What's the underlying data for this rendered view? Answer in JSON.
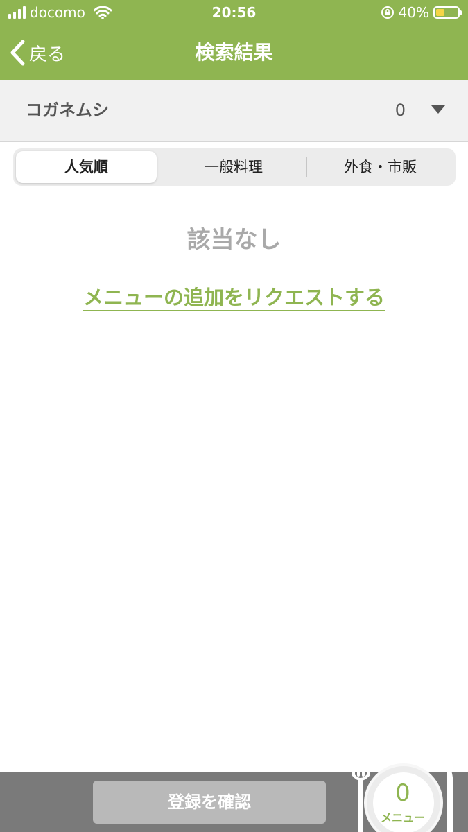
{
  "status_bar": {
    "carrier": "docomo",
    "time": "20:56",
    "battery_percent": "40%",
    "battery_level": 0.4,
    "battery_color": "#f5d547"
  },
  "nav": {
    "back_label": "戻る",
    "title": "検索結果",
    "background_color": "#8fb551"
  },
  "filter": {
    "search_term": "コガネムシ",
    "count": "0"
  },
  "tabs": [
    {
      "label": "人気順",
      "active": true
    },
    {
      "label": "一般料理",
      "active": false
    },
    {
      "label": "外食・市販",
      "active": false
    }
  ],
  "results": {
    "empty_message": "該当なし",
    "request_link": "メニューの追加をリクエストする"
  },
  "bottom": {
    "confirm_button": "登録を確認",
    "menu_count": "0",
    "menu_label": "メニュー",
    "accent_color": "#8fb551"
  }
}
